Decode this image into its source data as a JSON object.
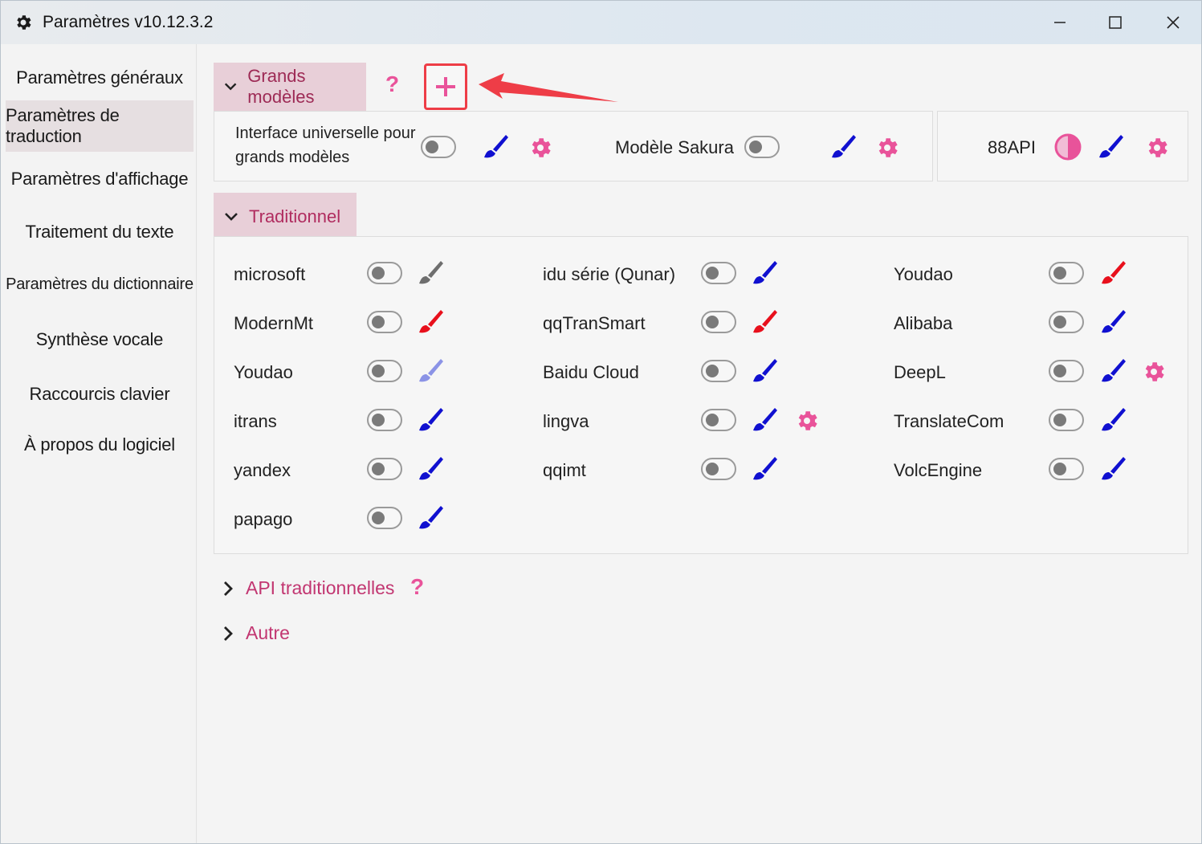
{
  "window": {
    "title": "Paramètres v10.12.3.2"
  },
  "sidebar": {
    "items": [
      {
        "label": "Paramètres généraux"
      },
      {
        "label": "Paramètres de traduction"
      },
      {
        "label": "Paramètres d'affichage"
      },
      {
        "label": "Traitement du texte"
      },
      {
        "label": "Paramètres du dictionnaire"
      },
      {
        "label": "Synthèse vocale"
      },
      {
        "label": "Raccourcis clavier"
      },
      {
        "label": "À propos du logiciel"
      }
    ],
    "active_index": 1
  },
  "llm_group": {
    "label": "Grands modèles",
    "items": [
      {
        "label_line1": "Interface universelle pour",
        "label_line2": "grands modèles",
        "enabled": false
      },
      {
        "label": "Modèle Sakura",
        "enabled": false
      },
      {
        "label": "88API",
        "enabled": "partial"
      }
    ]
  },
  "traditional_group": {
    "label": "Traditionnel",
    "items": [
      {
        "label": "microsoft",
        "enabled": false,
        "brush": "gray"
      },
      {
        "label": "idu série (Qunar)",
        "enabled": false,
        "brush": "blue"
      },
      {
        "label": "Youdao",
        "enabled": false,
        "brush": "red"
      },
      {
        "label": "ModernMt",
        "enabled": false,
        "brush": "red"
      },
      {
        "label": "qqTranSmart",
        "enabled": false,
        "brush": "red"
      },
      {
        "label": "Alibaba",
        "enabled": false,
        "brush": "blue"
      },
      {
        "label": "Youdao",
        "enabled": false,
        "brush": "lightblue"
      },
      {
        "label": "Baidu Cloud",
        "enabled": false,
        "brush": "blue"
      },
      {
        "label": "DeepL",
        "enabled": false,
        "brush": "blue",
        "settings": true
      },
      {
        "label": "itrans",
        "enabled": false,
        "brush": "blue"
      },
      {
        "label": "lingva",
        "enabled": false,
        "brush": "blue",
        "settings": true
      },
      {
        "label": "TranslateCom",
        "enabled": false,
        "brush": "blue"
      },
      {
        "label": "yandex",
        "enabled": false,
        "brush": "blue"
      },
      {
        "label": "qqimt",
        "enabled": false,
        "brush": "blue"
      },
      {
        "label": "VolcEngine",
        "enabled": false,
        "brush": "blue"
      },
      {
        "label": "papago",
        "enabled": false,
        "brush": "blue"
      }
    ]
  },
  "collapsed_groups": [
    {
      "label": "API traditionnelles",
      "has_help": true
    },
    {
      "label": "Autre",
      "has_help": false
    }
  ],
  "help_glyph": "?",
  "colors": {
    "accent_pink": "#e9539a",
    "header_bg": "#e8cfd8",
    "header_text": "#9d2a55",
    "brush_blue": "#1010d0",
    "brush_red": "#e8101c",
    "brush_gray": "#6e6e6e",
    "brush_lightblue": "#8b93e6",
    "highlight_red": "#ee3d47"
  }
}
